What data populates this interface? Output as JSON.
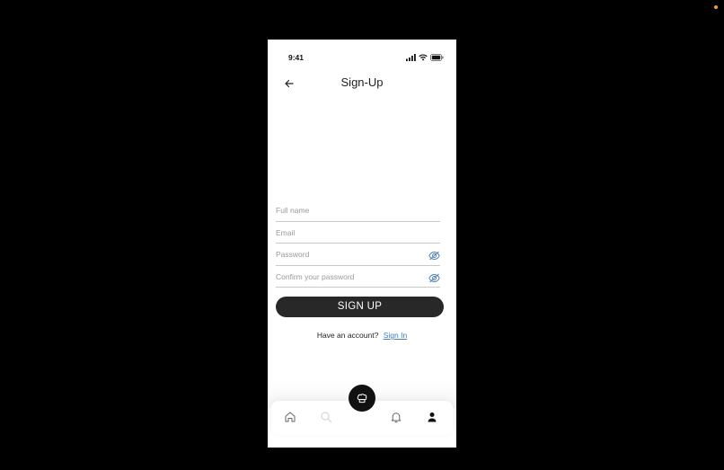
{
  "status_bar": {
    "time": "9:41"
  },
  "header": {
    "title": "Sign-Up"
  },
  "form": {
    "full_name": {
      "placeholder": "Full name",
      "value": ""
    },
    "email": {
      "placeholder": "Email",
      "value": ""
    },
    "password": {
      "placeholder": "Password",
      "value": ""
    },
    "confirm_password": {
      "placeholder": "Confirm your password",
      "value": ""
    }
  },
  "signup_button": {
    "label": "SIGN UP"
  },
  "signin_prompt": {
    "text": "Have an account?",
    "link_label": "Sign In"
  },
  "bottom_nav": {
    "items": [
      {
        "icon": "home-icon"
      },
      {
        "icon": "search-icon"
      },
      {
        "icon": "chef-hat-icon"
      },
      {
        "icon": "bell-icon"
      },
      {
        "icon": "profile-icon"
      }
    ]
  },
  "colors": {
    "background": "#000000",
    "screen": "#ffffff",
    "primary_button": "#282828",
    "link": "#3b7fc4",
    "eye_icon": "#4a7fb5",
    "placeholder": "#9a9a9a"
  }
}
